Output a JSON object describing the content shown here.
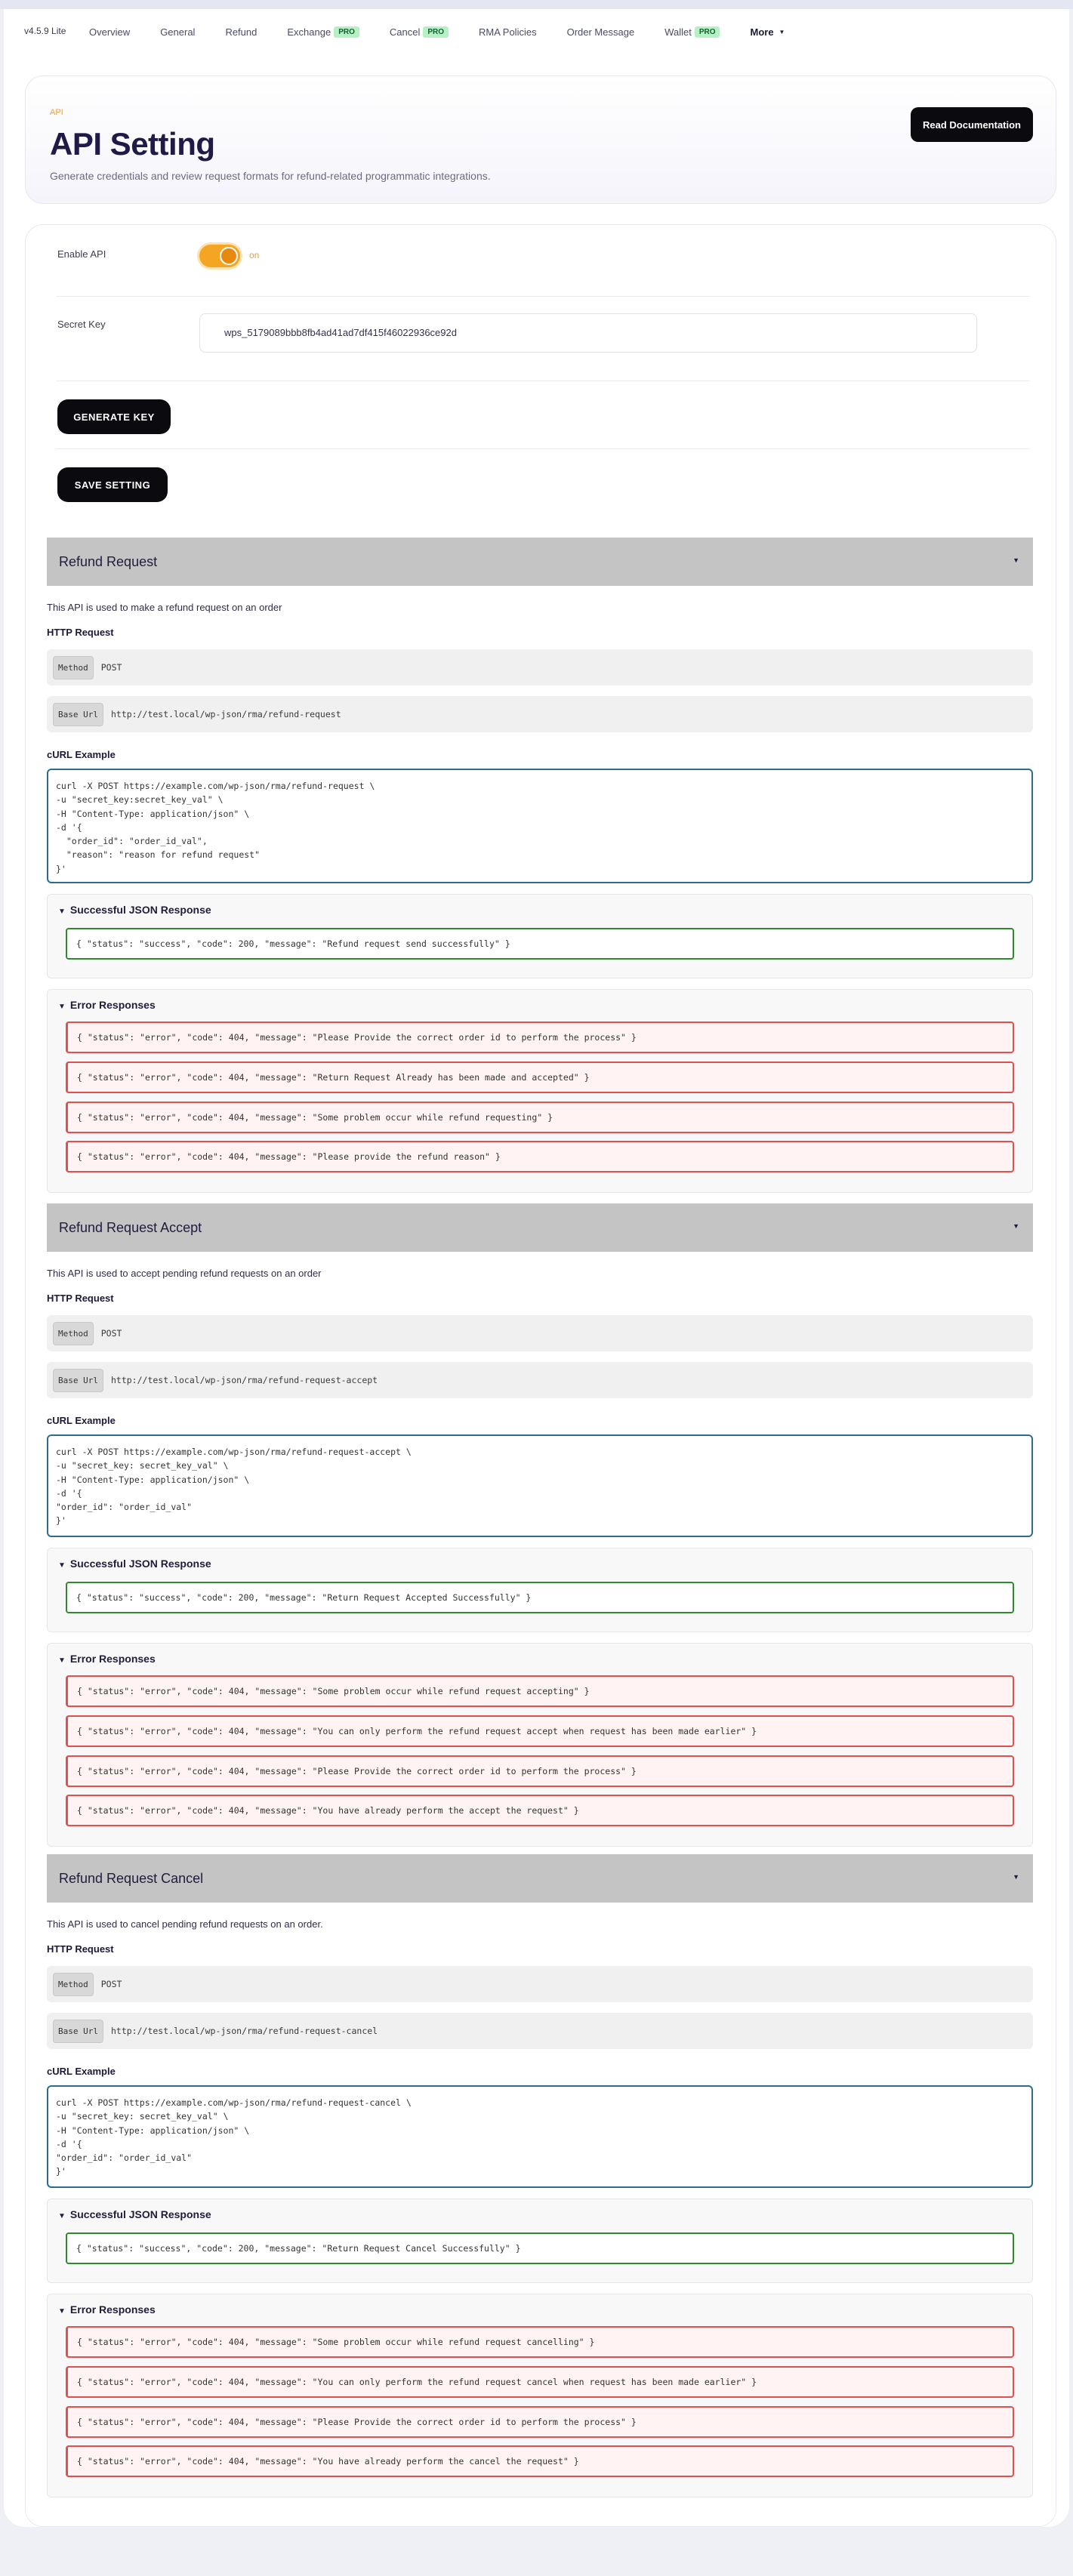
{
  "version": "v4.5.9 Lite",
  "nav": {
    "items": [
      {
        "label": "Overview",
        "pro": ""
      },
      {
        "label": "General",
        "pro": ""
      },
      {
        "label": "Refund",
        "pro": ""
      },
      {
        "label": "Exchange",
        "pro": "PRO"
      },
      {
        "label": "Cancel",
        "pro": "PRO"
      },
      {
        "label": "RMA Policies",
        "pro": ""
      },
      {
        "label": "Order Message",
        "pro": ""
      },
      {
        "label": "Wallet",
        "pro": "PRO"
      }
    ],
    "more": "More"
  },
  "header": {
    "eyebrow": "API",
    "title": "API Setting",
    "description": "Generate credentials and review request formats for refund-related programmatic integrations.",
    "doc_button": "Read Documentation"
  },
  "settings": {
    "enable_label": "Enable API",
    "toggle_state": "on",
    "secret_label": "Secret Key",
    "secret_value": "wps_5179089bbb8fb4ad41ad7df415f46022936ce92d",
    "generate_button": "GENERATE KEY",
    "save_button": "SAVE SETTING"
  },
  "common": {
    "http_request": "HTTP Request",
    "method_tag": "Method",
    "base_url_tag": "Base Url",
    "curl_example": "cURL Example",
    "success_title": "Successful JSON Response",
    "error_title": "Error Responses"
  },
  "sections": [
    {
      "title": "Refund Request",
      "description": "This API is used to make a refund request on an order",
      "method": "POST",
      "base_url": "http://test.local/wp-json/rma/refund-request",
      "curl": "curl -X POST https://example.com/wp-json/rma/refund-request \\\n-u \"secret_key:secret_key_val\" \\\n-H \"Content-Type: application/json\" \\\n-d '{\n  \"order_id\": \"order_id_val\",\n  \"reason\": \"reason for refund request\"\n}'",
      "success": "{ \"status\": \"success\", \"code\": 200, \"message\": \"Refund request send successfully\" }",
      "errors": [
        "{ \"status\": \"error\", \"code\": 404, \"message\": \"Please Provide the correct order id to perform the process\" }",
        "{ \"status\": \"error\", \"code\": 404, \"message\": \"Return Request Already has been made and accepted\" }",
        "{ \"status\": \"error\", \"code\": 404, \"message\": \"Some problem occur while refund requesting\" }",
        "{ \"status\": \"error\", \"code\": 404, \"message\": \"Please provide the refund reason\" }"
      ]
    },
    {
      "title": "Refund Request Accept",
      "description": "This API is used to accept pending refund requests on an order",
      "method": "POST",
      "base_url": "http://test.local/wp-json/rma/refund-request-accept",
      "curl": "curl -X POST https://example.com/wp-json/rma/refund-request-accept \\\n-u \"secret_key: secret_key_val\" \\\n-H \"Content-Type: application/json\" \\\n-d '{\n\"order_id\": \"order_id_val\"\n}'",
      "success": "{ \"status\": \"success\", \"code\": 200, \"message\": \"Return Request Accepted Successfully\" }",
      "errors": [
        "{ \"status\": \"error\", \"code\": 404, \"message\": \"Some problem occur while refund request accepting\" }",
        "{ \"status\": \"error\", \"code\": 404, \"message\": \"You can only perform the refund request accept when request has been made earlier\" }",
        "{ \"status\": \"error\", \"code\": 404, \"message\": \"Please Provide the correct order id to perform the process\" }",
        "{ \"status\": \"error\", \"code\": 404, \"message\": \"You have already perform the accept the request\" }"
      ]
    },
    {
      "title": "Refund Request Cancel",
      "description": "This API is used to cancel pending refund requests on an order.",
      "method": "POST",
      "base_url": "http://test.local/wp-json/rma/refund-request-cancel",
      "curl": "curl -X POST https://example.com/wp-json/rma/refund-request-cancel \\\n-u \"secret_key: secret_key_val\" \\\n-H \"Content-Type: application/json\" \\\n-d '{\n\"order_id\": \"order_id_val\"\n}'",
      "success": "{ \"status\": \"success\", \"code\": 200, \"message\": \"Return Request Cancel Successfully\" }",
      "errors": [
        "{ \"status\": \"error\", \"code\": 404, \"message\": \"Some problem occur while refund request cancelling\" }",
        "{ \"status\": \"error\", \"code\": 404, \"message\": \"You can only perform the refund request cancel when request has been made earlier\" }",
        "{ \"status\": \"error\", \"code\": 404, \"message\": \"Please Provide the correct order id to perform the process\" }",
        "{ \"status\": \"error\", \"code\": 404, \"message\": \"You have already perform the cancel the request\" }"
      ]
    }
  ]
}
